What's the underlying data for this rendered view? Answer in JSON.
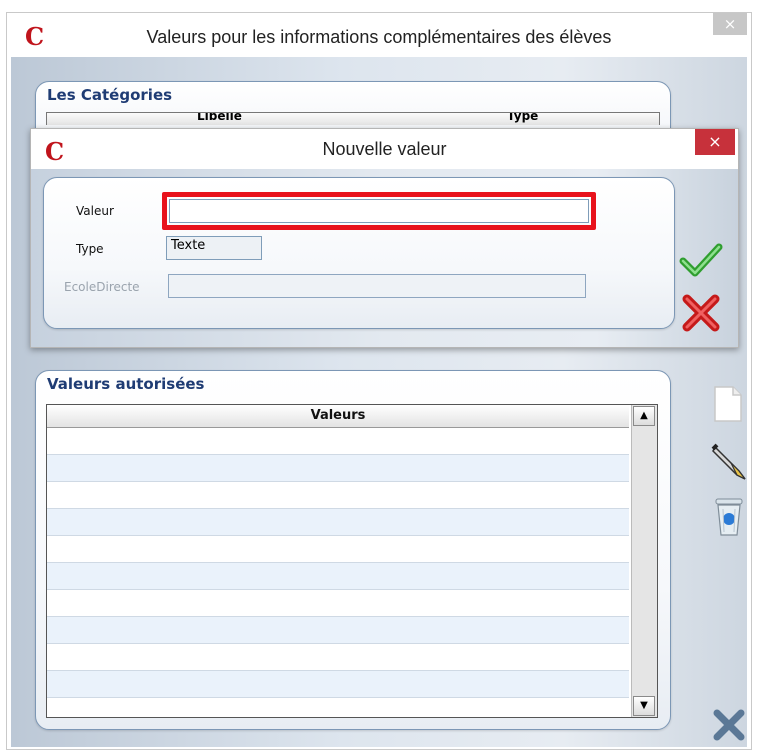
{
  "main_window": {
    "title": "Valeurs pour les informations complémentaires des élèves",
    "close_glyph": "×",
    "logo": "C",
    "categories_group": {
      "title": "Les Catégories",
      "column_label": "Libellé",
      "column_type": "Type"
    },
    "values_group": {
      "title": "Valeurs autorisées",
      "column_header": "Valeurs",
      "row_count": 10
    },
    "side_icons": [
      "new-document-icon",
      "edit-pen-icon",
      "recycle-bin-icon"
    ],
    "corner_icon": "close-x-icon"
  },
  "dialog": {
    "title": "Nouvelle valeur",
    "close_glyph": "×",
    "logo": "C",
    "fields": {
      "valeur_label": "Valeur",
      "valeur_value": "",
      "type_label": "Type",
      "type_value": "Texte",
      "ecoledirecte_label": "EcoleDirecte",
      "ecoledirecte_value": ""
    },
    "icons": [
      "green-check-icon",
      "red-cross-icon"
    ]
  },
  "colors": {
    "accent_title": "#1f3c74",
    "logo_red": "#c0141c",
    "highlight_red": "#e8121c",
    "dialog_close_bg": "#c7313b",
    "row_alt": "#eaf2fb"
  }
}
